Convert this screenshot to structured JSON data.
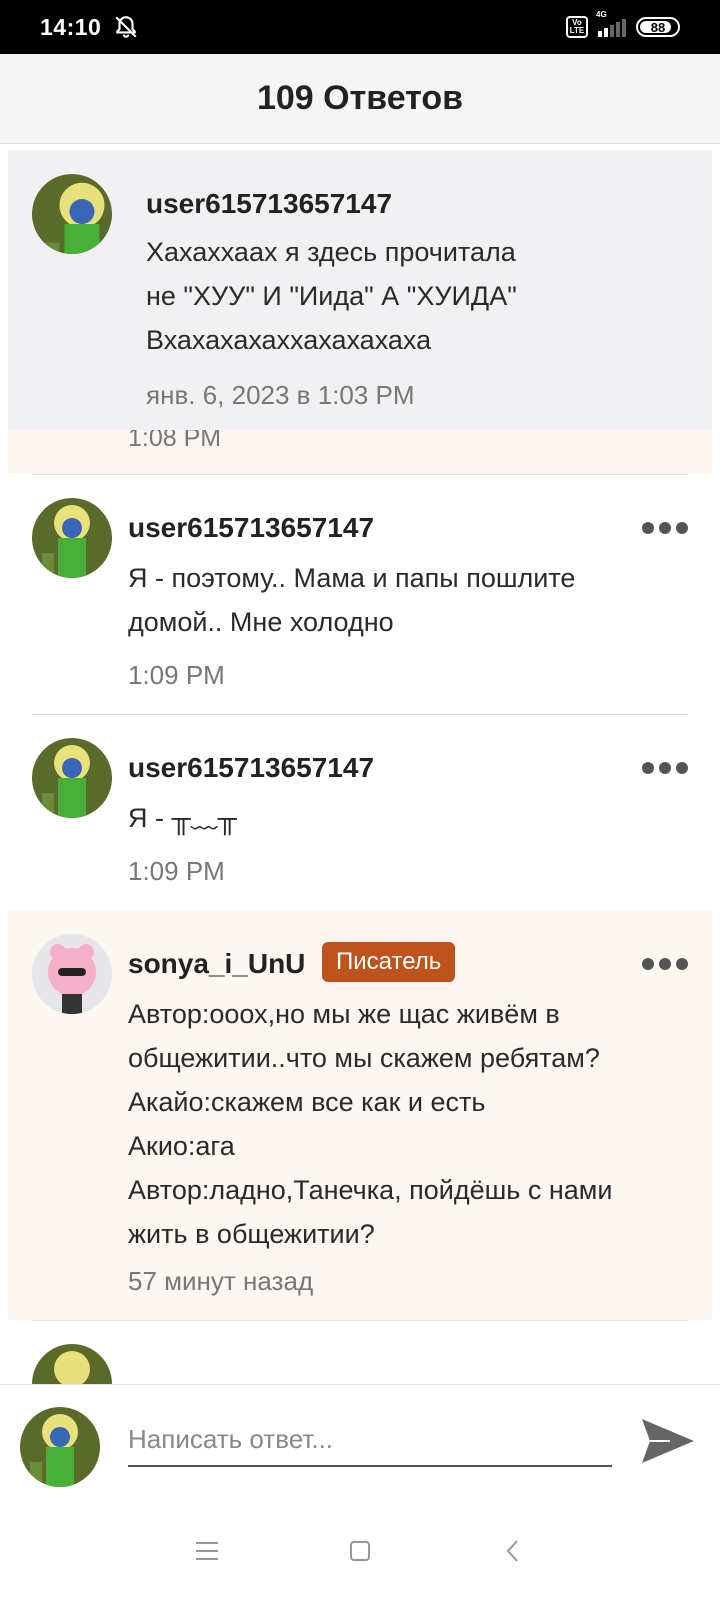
{
  "status_bar": {
    "time": "14:10",
    "network": "4G",
    "battery": "88",
    "battery_level": 0.88
  },
  "header": {
    "title": "109 Ответов"
  },
  "partial_time": "1:08 PM",
  "comments": [
    {
      "username": "user615713657147",
      "text": "Хахаххаах я здесь прочитала\nне \"ХУУ\" И \"Иида\" А \"ХУИДА\"\nВхахахахаххахахахаха",
      "time": "янв. 6, 2023 в 1:03 PM"
    },
    {
      "username": "user615713657147",
      "text": "Я - поэтому.. Мама и папы пошлите\nдомой.. Мне холодно",
      "time": "1:09 PM"
    },
    {
      "username": "user615713657147",
      "text": "Я - ╥﹏╥",
      "time": "1:09 PM"
    },
    {
      "username": "sonya_i_UnU",
      "badge": "Писатель",
      "text": "Автор:ооох,но мы же щас живём в\nобщежитии..что мы скажем ребятам?\nАкайо:скажем все как и есть\nАкио:ага\nАвтор:ладно,Танечка, пойдёшь с нами\nжить в общежитии?",
      "time": "57 минут назад"
    }
  ],
  "compose": {
    "placeholder": "Написать ответ..."
  },
  "colors": {
    "badge": "#c0531b",
    "author_bg": "#fdf7f2",
    "highlight_bg": "#f1f1f4"
  }
}
